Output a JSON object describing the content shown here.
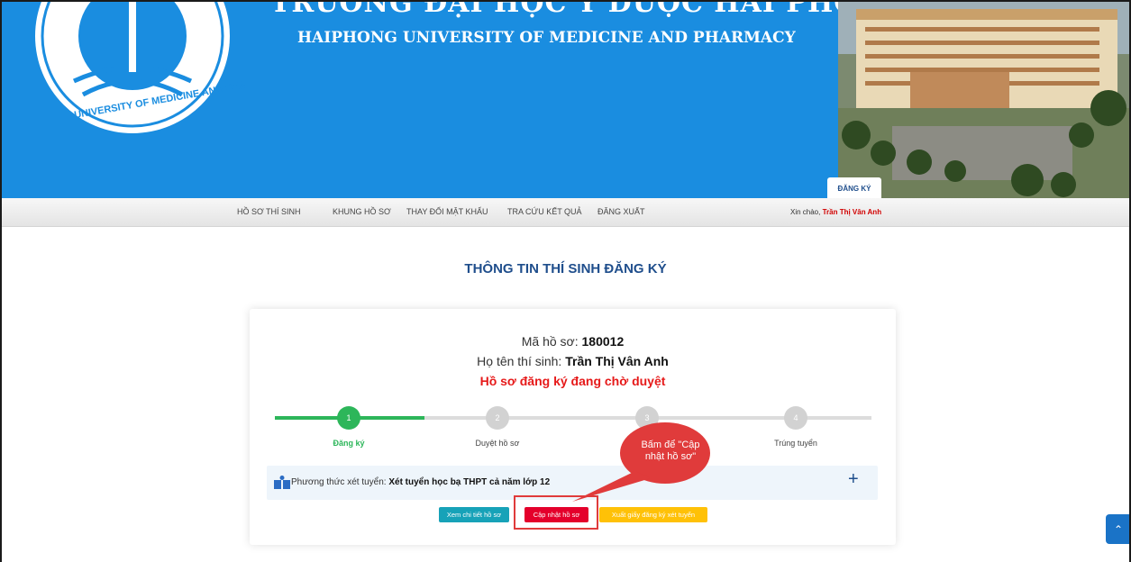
{
  "banner": {
    "title_vn": "TRƯỜNG ĐẠI HỌC Y DƯỢC HẢI PHÒNG",
    "title_en": "HAIPHONG UNIVERSITY OF MEDICINE AND PHARMACY",
    "logo_text": "HAIPHONG UNIVERSITY OF MEDICINE AND PHARMACY",
    "tab_label": "ĐĂNG KÝ"
  },
  "nav": {
    "items": [
      "HỒ SƠ THÍ SINH",
      "KHUNG HỒ SƠ",
      "THAY ĐỔI MẬT KHẨU",
      "TRA CỨU KẾT QUẢ",
      "ĐĂNG XUẤT"
    ],
    "greeting": "Xin chào,",
    "user_name": "Trần Thị Vân Anh"
  },
  "page_title": "THÔNG TIN THÍ SINH ĐĂNG KÝ",
  "profile": {
    "code_label": "Mã hồ sơ:",
    "code_value": "180012",
    "name_label": "Họ tên thí sinh:",
    "name_value": "Trần Thị Vân Anh",
    "status": "Hồ sơ đăng ký đang chờ duyệt"
  },
  "steps": [
    {
      "number": "1",
      "label": "Đăng ký"
    },
    {
      "number": "2",
      "label": "Duyệt hồ sơ"
    },
    {
      "number": "3",
      "label": ""
    },
    {
      "number": "4",
      "label": "Trúng tuyển"
    }
  ],
  "method": {
    "label": "Phương thức xét tuyển:",
    "value": "Xét tuyển học bạ THPT cả năm lớp 12",
    "expand_icon": "plus-icon"
  },
  "buttons": {
    "view": "Xem chi tiết hồ sơ",
    "update": "Cập nhật hồ sơ",
    "export": "Xuất giấy đăng ký xét tuyển"
  },
  "callout": {
    "line1": "Bấm để \"Cập",
    "line2": "nhật hồ sơ\""
  },
  "colors": {
    "banner": "#1a8de0",
    "accent_green": "#2db65a",
    "status_red": "#e61a1a",
    "callout_red": "#e03b3b",
    "title_blue": "#1f4e8c"
  }
}
